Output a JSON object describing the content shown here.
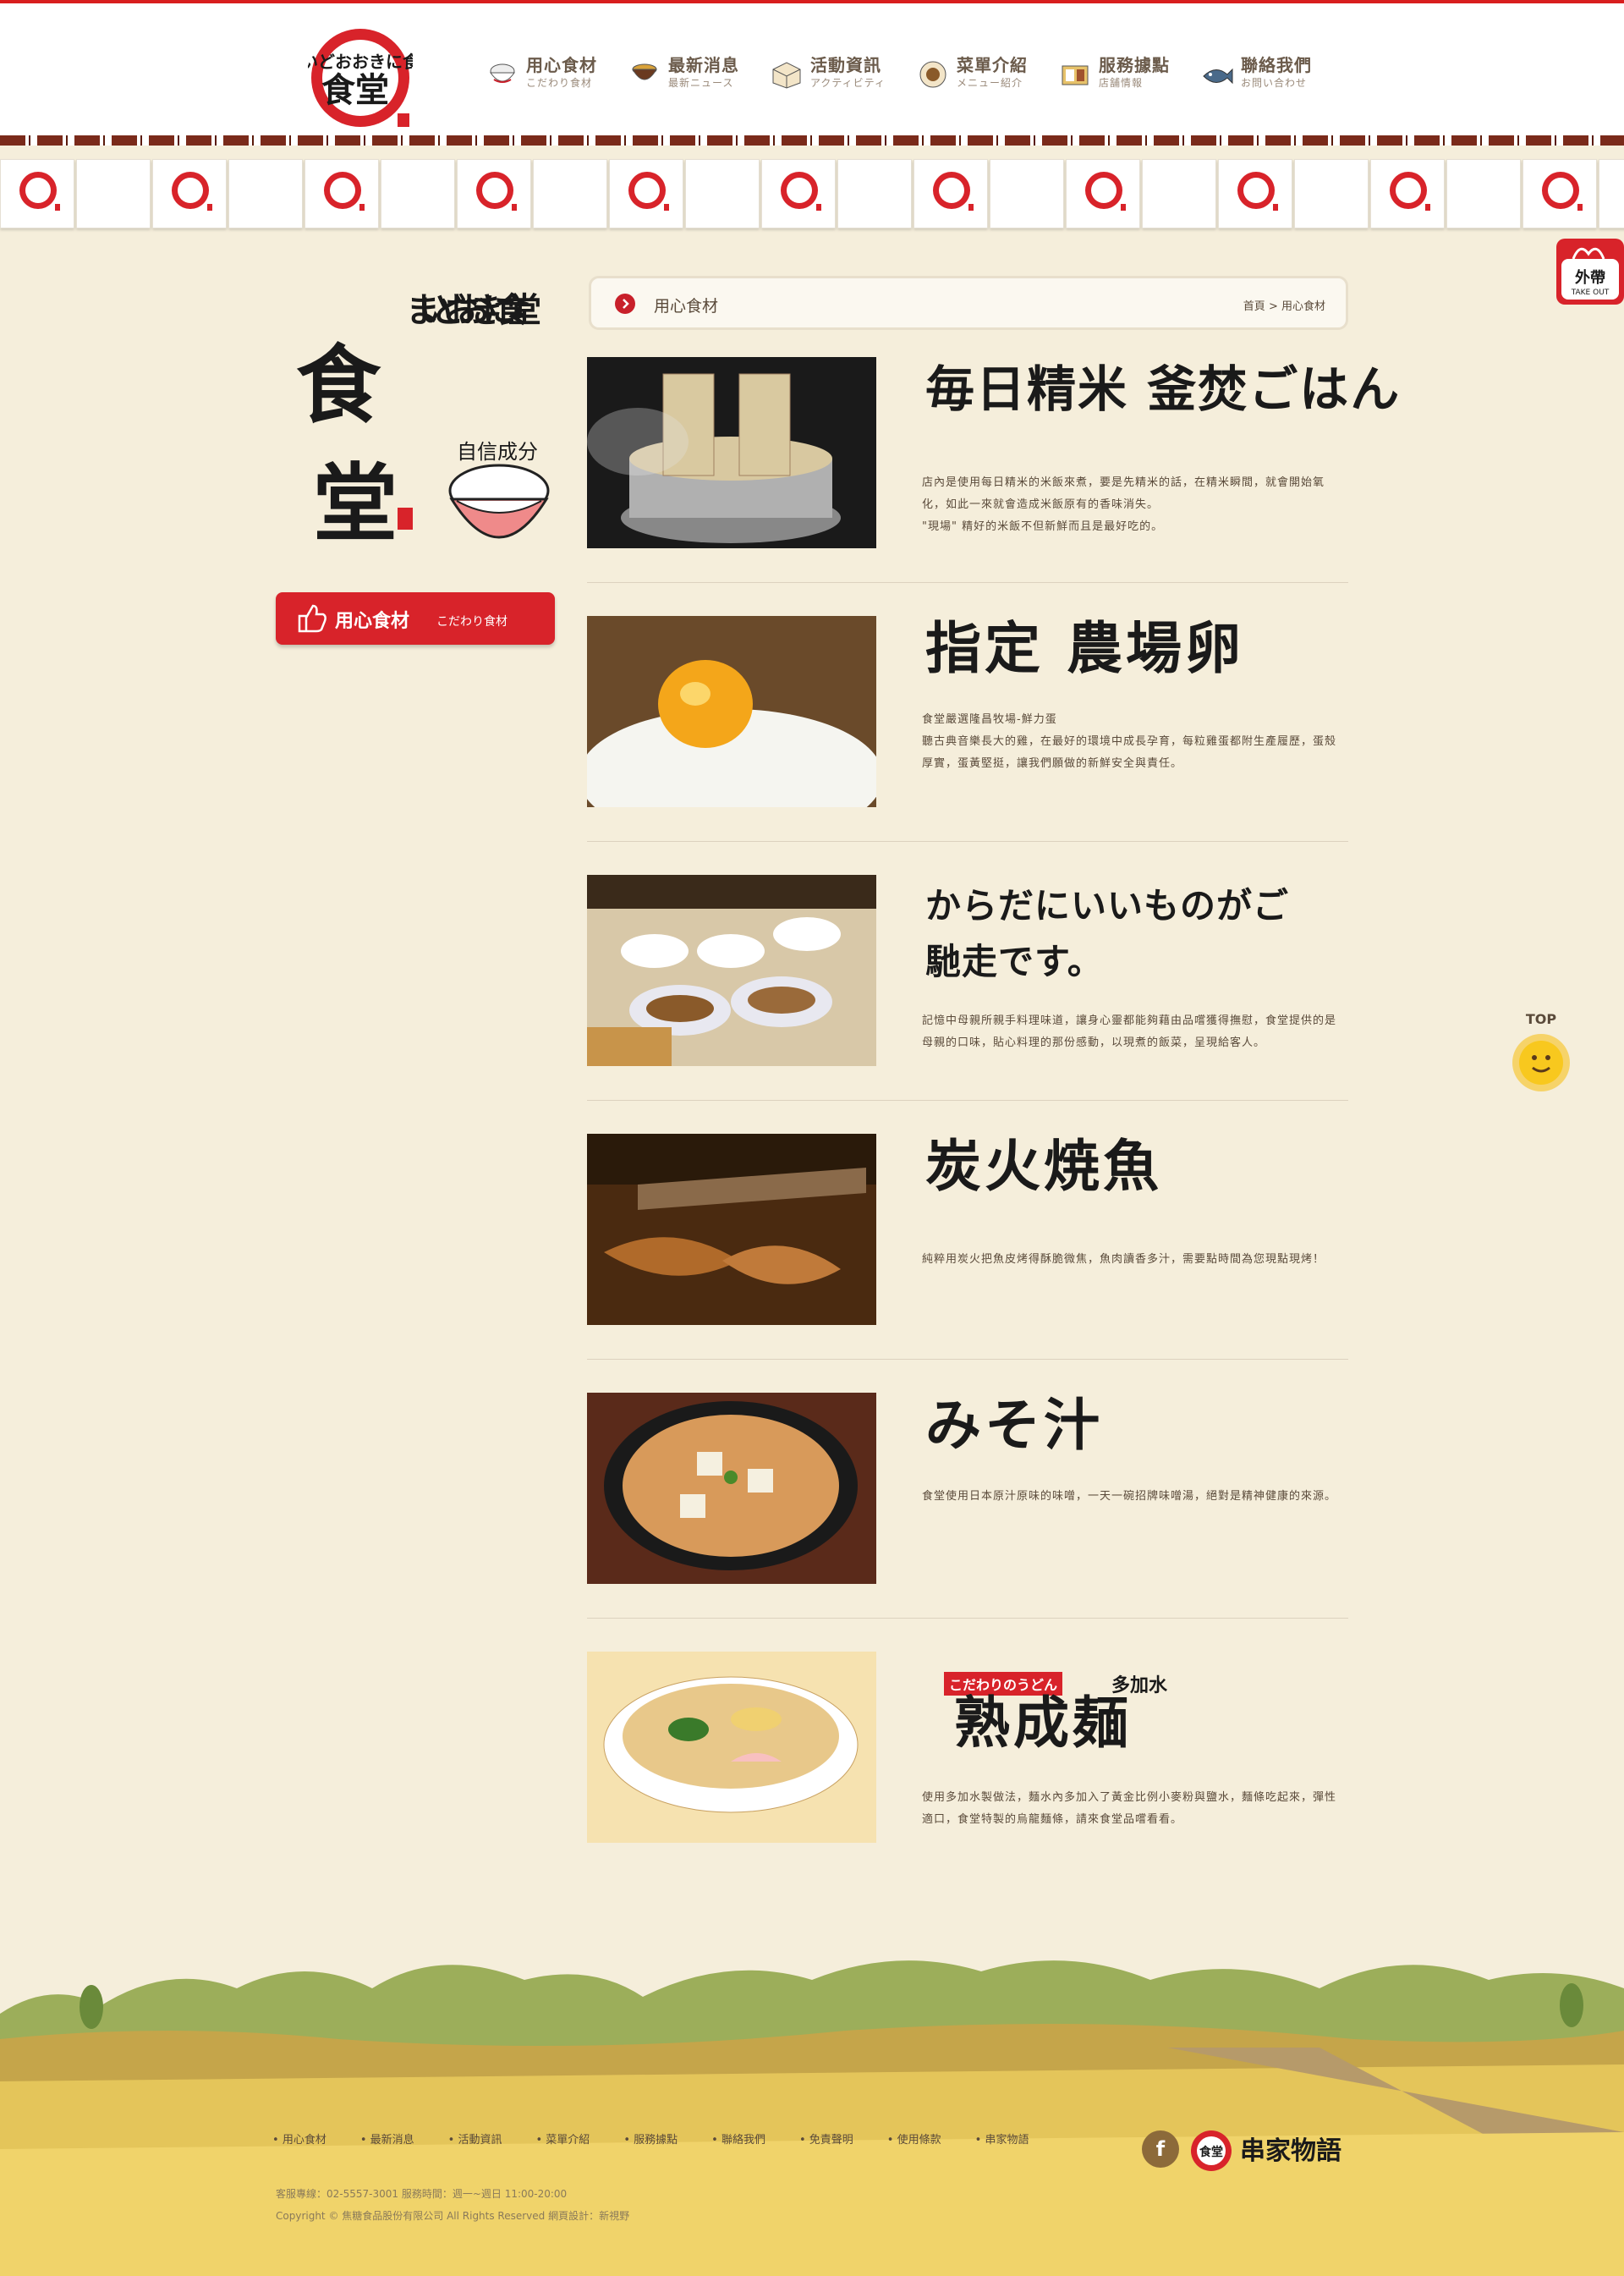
{
  "header": {
    "logo_text": "まいどおおきに食堂",
    "nav": [
      {
        "label": "用心食材",
        "sub": "こだわり食材",
        "icon": "rice-bowl-icon"
      },
      {
        "label": "最新消息",
        "sub": "最新ニュース",
        "icon": "soup-bowl-icon"
      },
      {
        "label": "活動資訊",
        "sub": "アクティビティ",
        "icon": "rice-box-icon"
      },
      {
        "label": "菜單介紹",
        "sub": "メニュー紹介",
        "icon": "dish-icon"
      },
      {
        "label": "服務據點",
        "sub": "店舗情報",
        "icon": "bento-icon"
      },
      {
        "label": "聯絡我們",
        "sub": "お問い合わせ",
        "icon": "fish-icon"
      }
    ]
  },
  "takeout": {
    "label": "外帶",
    "sub": "TAKE OUT"
  },
  "top_button": {
    "label": "TOP"
  },
  "sidebar": {
    "logo_text": "まいどおおきに食堂",
    "badge": "自信成分",
    "tab_label": "用心食材",
    "tab_sub": "こだわり食材"
  },
  "breadcrumb": {
    "title": "用心食材",
    "home": "首頁",
    "separator": ">",
    "current": "用心食材"
  },
  "items": [
    {
      "title": "毎日精米 釜焚ごはん",
      "desc": "店內是使用每日精米的米飯來煮，要是先精米的話，在精米瞬間，就會開始氧化，如此一來就會造成米飯原有的香味消失。\n\"現場\" 精好的米飯不但新鮮而且是最好吃的。"
    },
    {
      "title": "指定 農場卵",
      "desc": "食堂嚴選隆昌牧場-鮮力蛋\n聽古典音樂長大的雞，在最好的環境中成長孕育，每粒雞蛋都附生產履歷，蛋殼厚實，蛋黃堅挺，讓我們願做的新鮮安全與責任。"
    },
    {
      "title": "からだにいいものがご馳走です。",
      "desc": "記憶中母親所親手料理味道，讓身心靈都能夠藉由品嚐獲得撫慰，食堂提供的是母親的口味，貼心料理的那份感動，以現煮的飯菜，呈現給客人。"
    },
    {
      "title": "炭火焼魚",
      "desc": "純粹用炭火把魚皮烤得酥脆微焦，魚肉讀香多汁，需要點時間為您現點現烤！"
    },
    {
      "title": "みそ汁",
      "desc": "食堂使用日本原汁原味的味噌，一天一碗招牌味噌湯，絕對是精神健康的來源。"
    },
    {
      "title": "熟成麺",
      "tag": "こだわりのうどん",
      "tag2": "多加水",
      "desc": "使用多加水製做法，麵水內多加入了黃金比例小麥粉與鹽水，麵條吃起來，彈性適口，食堂特製的烏龍麵條，請來食堂品嚐看看。"
    }
  ],
  "footer": {
    "links": [
      "用心食材",
      "最新消息",
      "活動資訊",
      "菜單介紹",
      "服務據點",
      "聯絡我們",
      "免責聲明",
      "使用條款",
      "串家物語"
    ],
    "hotline": "客服專線：02-5557-3001   服務時間：週一~週日 11:00-20:00",
    "copyright": "Copyright © 焦糖食品股份有限公司 All Rights Reserved  網頁設計：新視野",
    "fb_label": "f",
    "brand": "串家物語"
  },
  "colors": {
    "background": "#f5eedb",
    "accent": "#d8232a",
    "text": "#5a4a3a"
  }
}
